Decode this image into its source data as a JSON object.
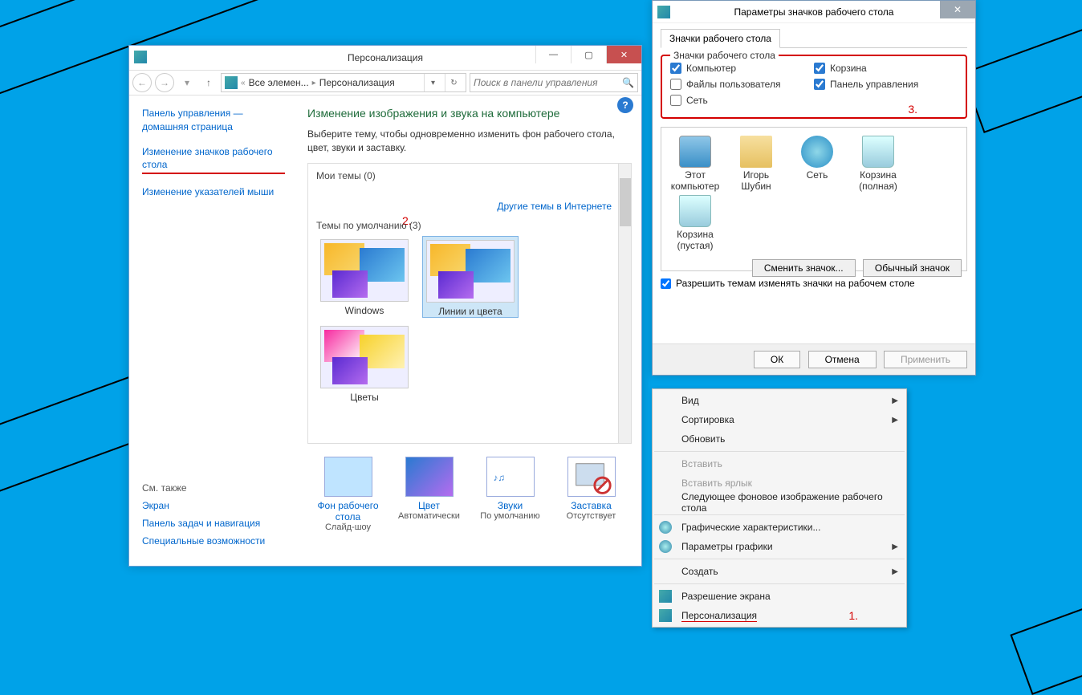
{
  "person_window": {
    "title": "Персонализация",
    "breadcrumb": {
      "prev": "Все элемен...",
      "current": "Персонализация"
    },
    "search_placeholder": "Поиск в панели управления",
    "sidebar": {
      "home": "Панель управления — домашняя страница",
      "change_icons": "Изменение значков рабочего стола",
      "change_cursors": "Изменение указателей мыши",
      "annot": "2."
    },
    "see_also": {
      "heading": "См. также",
      "links": [
        "Экран",
        "Панель задач и навигация",
        "Специальные возможности"
      ]
    },
    "main": {
      "heading": "Изменение изображения и звука на компьютере",
      "sub": "Выберите тему, чтобы одновременно изменить фон рабочего стола, цвет, звуки и заставку.",
      "my_themes": "Мои темы (0)",
      "link_online": "Другие темы в Интернете",
      "default_themes": "Темы по умолчанию (3)",
      "themes": [
        "Windows",
        "Линии и цвета",
        "Цветы"
      ],
      "bottom": {
        "bg": {
          "t": "Фон рабочего стола",
          "s": "Слайд-шоу"
        },
        "color": {
          "t": "Цвет",
          "s": "Автоматически"
        },
        "sound": {
          "t": "Звуки",
          "s": "По умолчанию"
        },
        "saver": {
          "t": "Заставка",
          "s": "Отсутствует"
        }
      }
    }
  },
  "icons_dialog": {
    "title": "Параметры значков рабочего стола",
    "tab": "Значки рабочего стола",
    "groupbox_legend": "Значки рабочего стола",
    "annot": "3.",
    "checks": {
      "computer": "Компьютер",
      "bin": "Корзина",
      "userfiles": "Файлы пользователя",
      "cpl": "Панель управления",
      "network": "Сеть"
    },
    "icons": [
      "Этот компьютер",
      "Игорь Шубин",
      "Сеть",
      "Корзина (полная)",
      "Корзина (пустая)"
    ],
    "btn_change": "Сменить значок...",
    "btn_default": "Обычный значок",
    "allow_themes": "Разрешить темам изменять значки на рабочем столе",
    "ok": "ОК",
    "cancel": "Отмена",
    "apply": "Применить"
  },
  "context_menu": {
    "view": "Вид",
    "sort": "Сортировка",
    "refresh": "Обновить",
    "paste": "Вставить",
    "paste_shortcut": "Вставить ярлык",
    "next_bg": "Следующее фоновое изображение рабочего стола",
    "gfx_props": "Графические характеристики...",
    "gfx_params": "Параметры графики",
    "new": "Создать",
    "resolution": "Разрешение экрана",
    "personalize": "Персонализация",
    "annot": "1."
  }
}
